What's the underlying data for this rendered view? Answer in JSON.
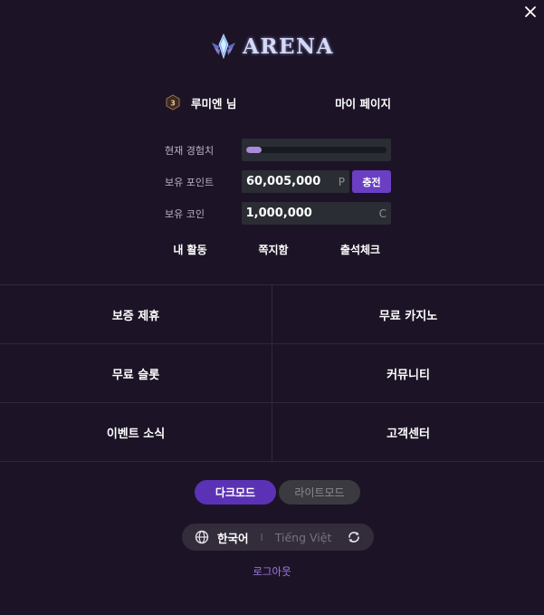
{
  "header": {
    "close_icon": "close-icon"
  },
  "logo": {
    "text": "ARENA",
    "icon": "crystal-emblem-icon"
  },
  "profile": {
    "level": "3",
    "username": "루미엔 님",
    "mypage_label": "마이 페이지"
  },
  "stats": {
    "xp_label": "현재 경험치",
    "xp_progress": 0.11,
    "points_label": "보유 포인트",
    "points_value": "60,005,000",
    "points_unit": "P",
    "charge_label": "충전",
    "coins_label": "보유 코인",
    "coins_value": "1,000,000",
    "coins_unit": "C"
  },
  "quick_links": {
    "activity": "내 활동",
    "messages": "쪽지함",
    "attendance": "출석체크"
  },
  "menu": [
    [
      "보증 제휴",
      "무료 카지노"
    ],
    [
      "무료 슬롯",
      "커뮤니티"
    ],
    [
      "이벤트 소식",
      "고객센터"
    ]
  ],
  "theme": {
    "dark_label": "다크모드",
    "light_label": "라이트모드",
    "selected": "dark"
  },
  "language": {
    "korean": "한국어",
    "separator": "I",
    "vietnamese": "Tiếng Việt"
  },
  "logout_label": "로그아웃",
  "colors": {
    "background": "#1c1426",
    "accent": "#6a3fc4",
    "xp_fill": "#a98bd9",
    "logout_link": "#a47be6"
  }
}
